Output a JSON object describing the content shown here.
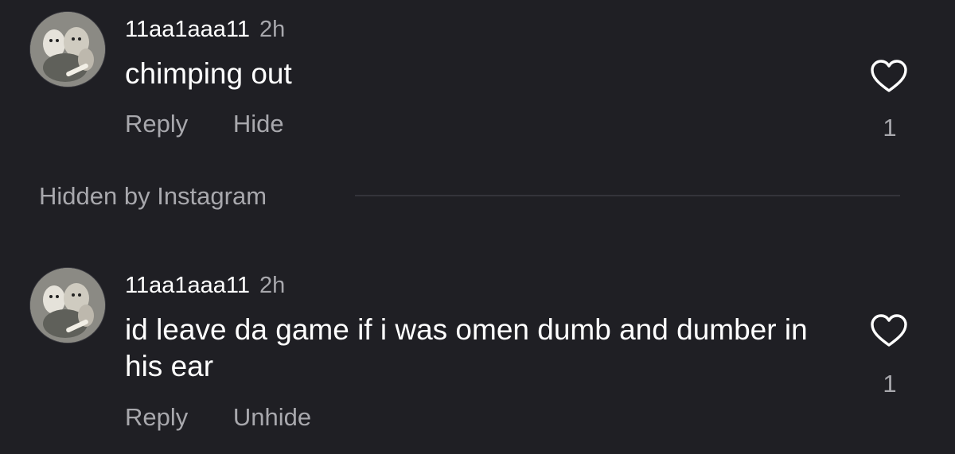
{
  "comments": [
    {
      "username": "11aa1aaa11",
      "time": "2h",
      "text": "chimping out",
      "reply_label": "Reply",
      "toggle_label": "Hide",
      "like_count": "1"
    },
    {
      "username": "11aa1aaa11",
      "time": "2h",
      "text": "id leave da game if i was omen dumb and dumber in his ear",
      "reply_label": "Reply",
      "toggle_label": "Unhide",
      "like_count": "1"
    }
  ],
  "hidden_section": {
    "label": "Hidden by Instagram"
  },
  "icons": {
    "like": "heart-outline-icon"
  },
  "colors": {
    "background": "#1f1f24",
    "primary_text": "#ffffff",
    "secondary_text": "#a8a8ad"
  }
}
